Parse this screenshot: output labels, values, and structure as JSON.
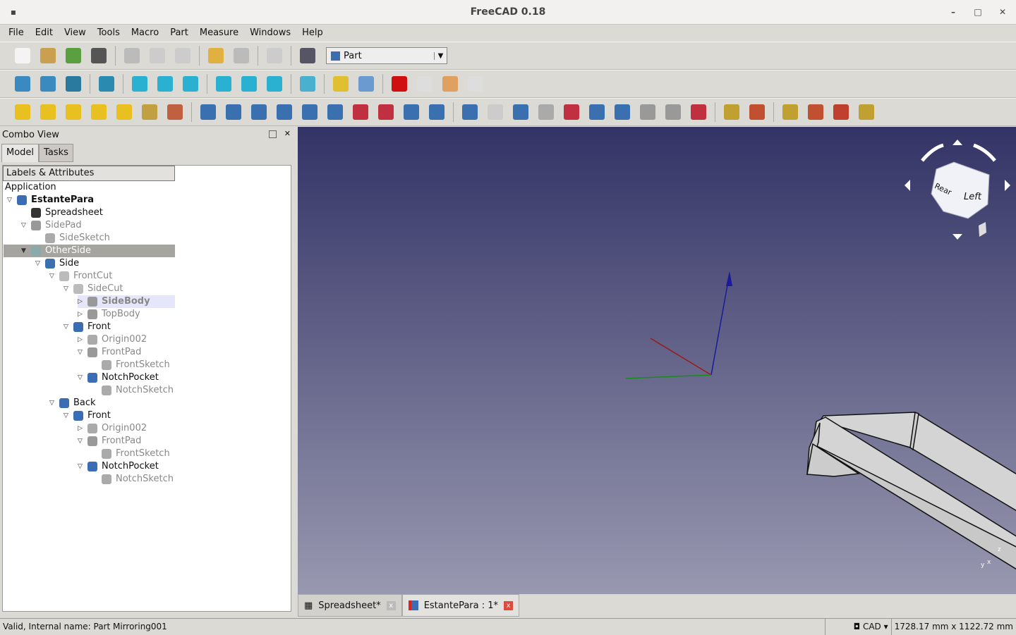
{
  "window": {
    "title": "FreeCAD 0.18",
    "minimize": "–",
    "maximize": "□",
    "close": "✕"
  },
  "menu": [
    "File",
    "Edit",
    "View",
    "Tools",
    "Macro",
    "Part",
    "Measure",
    "Windows",
    "Help"
  ],
  "toolbars": {
    "row1": [
      {
        "n": "new-icon",
        "c": "#f4f4f4"
      },
      {
        "n": "open-icon",
        "c": "#c8a050"
      },
      {
        "n": "save-icon",
        "c": "#5aa040"
      },
      {
        "n": "print-icon",
        "c": "#555"
      },
      null,
      {
        "n": "cut-icon",
        "c": "#bbb"
      },
      {
        "n": "copy-icon",
        "c": "#ccc"
      },
      {
        "n": "paste-icon",
        "c": "#ccc"
      },
      null,
      {
        "n": "undo-icon",
        "c": "#e0b040"
      },
      {
        "n": "redo-icon",
        "c": "#bbb"
      },
      null,
      {
        "n": "refresh-icon",
        "c": "#ccc"
      },
      null,
      {
        "n": "whats-this-icon",
        "c": "#556"
      }
    ],
    "workbench": "Part",
    "row2": [
      {
        "n": "fit-all-icon",
        "c": "#3a8ac0"
      },
      {
        "n": "fit-selection-icon",
        "c": "#3a8ac0"
      },
      {
        "n": "draw-style-icon",
        "c": "#2a7aa0"
      },
      null,
      {
        "n": "view-isometric-icon",
        "c": "#2a8ab0"
      },
      null,
      {
        "n": "view-front-icon",
        "c": "#2ab0d0"
      },
      {
        "n": "view-top-icon",
        "c": "#2ab0d0"
      },
      {
        "n": "view-right-icon",
        "c": "#2ab0d0"
      },
      null,
      {
        "n": "view-rear-icon",
        "c": "#2ab0d0"
      },
      {
        "n": "view-bottom-icon",
        "c": "#2ab0d0"
      },
      {
        "n": "view-left-icon",
        "c": "#2ab0d0"
      },
      null,
      {
        "n": "measure-icon",
        "c": "#4ab0d0"
      },
      null,
      {
        "n": "part-icon",
        "c": "#e0c030"
      },
      {
        "n": "group-icon",
        "c": "#6a9ad0"
      },
      null,
      {
        "n": "record-macro-icon",
        "c": "#d01010"
      },
      {
        "n": "stop-macro-icon",
        "c": "#ddd"
      },
      {
        "n": "edit-macro-icon",
        "c": "#e0a060"
      },
      {
        "n": "run-macro-icon",
        "c": "#ddd"
      }
    ],
    "row3": [
      {
        "n": "box-icon",
        "c": "#e8c020"
      },
      {
        "n": "cylinder-icon",
        "c": "#e8c020"
      },
      {
        "n": "sphere-icon",
        "c": "#e8c020"
      },
      {
        "n": "cone-icon",
        "c": "#e8c020"
      },
      {
        "n": "torus-icon",
        "c": "#e8c020"
      },
      {
        "n": "create-primitives-icon",
        "c": "#c0a040"
      },
      {
        "n": "shape-builder-icon",
        "c": "#c06040"
      },
      null,
      {
        "n": "extrude-icon",
        "c": "#3a70b0"
      },
      {
        "n": "revolve-icon",
        "c": "#3a70b0"
      },
      {
        "n": "mirror-icon",
        "c": "#3a70b0"
      },
      {
        "n": "fillet-icon",
        "c": "#3a70b0"
      },
      {
        "n": "chamfer-icon",
        "c": "#3a70b0"
      },
      {
        "n": "make-face-icon",
        "c": "#3a70b0"
      },
      {
        "n": "ruled-surface-icon",
        "c": "#c03040"
      },
      {
        "n": "loft-icon",
        "c": "#c03040"
      },
      {
        "n": "sweep-icon",
        "c": "#3a70b0"
      },
      {
        "n": "thickness-icon",
        "c": "#3a70b0"
      },
      null,
      {
        "n": "boolean-icon",
        "c": "#3a70b0"
      },
      {
        "n": "cut-shape-icon",
        "c": "#ccc"
      },
      {
        "n": "fuse-icon",
        "c": "#3a70b0"
      },
      {
        "n": "common-icon",
        "c": "#aaa"
      },
      {
        "n": "join-features-icon",
        "c": "#c03040"
      },
      {
        "n": "split-icon",
        "c": "#3a70b0"
      },
      {
        "n": "compound-icon",
        "c": "#3a70b0"
      },
      {
        "n": "check-geometry-icon",
        "c": "#999"
      },
      {
        "n": "defeaturing-icon",
        "c": "#999"
      },
      {
        "n": "cross-sections-icon",
        "c": "#c03040"
      },
      null,
      {
        "n": "attachment-icon",
        "c": "#c0a030"
      },
      {
        "n": "attachment-editor-icon",
        "c": "#c05030"
      },
      null,
      {
        "n": "section-icon",
        "c": "#c0a030"
      },
      {
        "n": "slice-icon",
        "c": "#c05030"
      },
      {
        "n": "explode-compound-icon",
        "c": "#c04030"
      },
      {
        "n": "compound-filter-icon",
        "c": "#c0a030"
      }
    ]
  },
  "combo": {
    "title": "Combo View",
    "tabs": [
      "Model",
      "Tasks"
    ],
    "column_header": "Labels & Attributes",
    "root": "Application",
    "tree": [
      {
        "label": "EstantePara",
        "depth": 0,
        "arrow": "open",
        "icon": "document-icon",
        "color": "#3a6db3",
        "bold": true
      },
      {
        "label": "Spreadsheet",
        "depth": 1,
        "arrow": "",
        "icon": "spreadsheet-icon",
        "color": "#333"
      },
      {
        "label": "SidePad",
        "depth": 1,
        "arrow": "open",
        "icon": "pad-icon",
        "color": "#999",
        "gray": true
      },
      {
        "label": "SideSketch",
        "depth": 2,
        "arrow": "",
        "icon": "sketch-icon",
        "color": "#aaa",
        "gray": true
      },
      {
        "label": "OtherSide",
        "depth": 1,
        "arrow": "open-filled",
        "icon": "mirror-icon",
        "color": "#8aa",
        "gray": true,
        "selected": true
      },
      {
        "label": "Side",
        "depth": 2,
        "arrow": "open",
        "icon": "fusion-icon",
        "color": "#3a70b0"
      },
      {
        "label": "FrontCut",
        "depth": 3,
        "arrow": "open",
        "icon": "cut-icon",
        "color": "#bbb",
        "gray": true
      },
      {
        "label": "SideCut",
        "depth": 4,
        "arrow": "open",
        "icon": "cut-error-icon",
        "color": "#bbb",
        "gray": true
      },
      {
        "label": "SideBody",
        "depth": 5,
        "arrow": "closed",
        "icon": "body-icon",
        "color": "#999",
        "gray": true,
        "bold": true,
        "highlight": true
      },
      {
        "label": "TopBody",
        "depth": 5,
        "arrow": "closed",
        "icon": "body-icon",
        "color": "#999",
        "gray": true
      },
      {
        "label": "Front",
        "depth": 4,
        "arrow": "open",
        "icon": "body-icon",
        "color": "#3a6db3"
      },
      {
        "label": "Origin002",
        "depth": 5,
        "arrow": "closed",
        "icon": "origin-icon",
        "color": "#aaa",
        "gray": true
      },
      {
        "label": "FrontPad",
        "depth": 5,
        "arrow": "open",
        "icon": "pad-icon",
        "color": "#999",
        "gray": true
      },
      {
        "label": "FrontSketch",
        "depth": 6,
        "arrow": "",
        "icon": "sketch-icon",
        "color": "#aaa",
        "gray": true
      },
      {
        "label": "NotchPocket",
        "depth": 5,
        "arrow": "open",
        "icon": "pocket-icon",
        "color": "#3a6db3"
      },
      {
        "label": "NotchSketch",
        "depth": 6,
        "arrow": "",
        "icon": "sketch-icon",
        "color": "#aaa",
        "gray": true
      },
      {
        "label": "Back",
        "depth": 3,
        "arrow": "open",
        "icon": "mirror-icon",
        "color": "#3a6db3"
      },
      {
        "label": "Front",
        "depth": 4,
        "arrow": "open",
        "icon": "body-icon",
        "color": "#3a6db3"
      },
      {
        "label": "Origin002",
        "depth": 5,
        "arrow": "closed",
        "icon": "origin-icon",
        "color": "#aaa",
        "gray": true
      },
      {
        "label": "FrontPad",
        "depth": 5,
        "arrow": "open",
        "icon": "pad-icon",
        "color": "#999",
        "gray": true
      },
      {
        "label": "FrontSketch",
        "depth": 6,
        "arrow": "",
        "icon": "sketch-icon",
        "color": "#aaa",
        "gray": true
      },
      {
        "label": "NotchPocket",
        "depth": 5,
        "arrow": "open",
        "icon": "pocket-icon",
        "color": "#3a6db3"
      },
      {
        "label": "NotchSketch",
        "depth": 6,
        "arrow": "",
        "icon": "sketch-icon",
        "color": "#aaa",
        "gray": true
      }
    ]
  },
  "navcube": {
    "faces": [
      "Rear",
      "Left"
    ],
    "axis_labels": [
      "z",
      "x",
      "y"
    ]
  },
  "doc_tabs": [
    {
      "label": "Spreadsheet*",
      "active": false
    },
    {
      "label": "EstantePara : 1*",
      "active": true
    }
  ],
  "status": {
    "message": "Valid, Internal name: Part   Mirroring001",
    "nav_style": "CAD",
    "dimensions": "1728.17 mm x 1122.72 mm"
  }
}
